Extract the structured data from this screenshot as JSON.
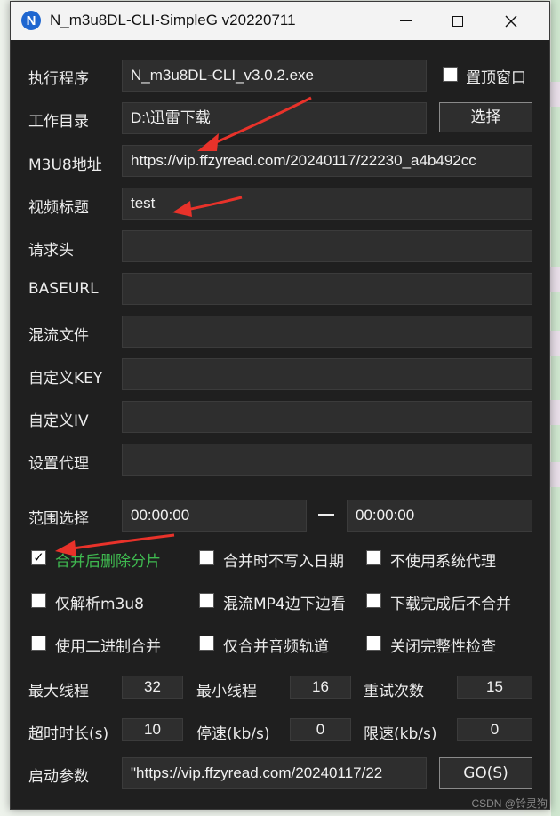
{
  "window": {
    "title": "N_m3u8DL-CLI-SimpleG v20220711",
    "app_icon_letter": "N"
  },
  "rows": {
    "exe": {
      "label": "执行程序",
      "value": "N_m3u8DL-CLI_v3.0.2.exe"
    },
    "topmost": {
      "label": "置顶窗口",
      "checked": false
    },
    "workdir": {
      "label": "工作目录",
      "value": "D:\\迅雷下载",
      "button": "选择"
    },
    "m3u8": {
      "label": "M3U8地址",
      "value": "https://vip.ffzyread.com/20240117/22230_a4b492cc"
    },
    "title": {
      "label": "视频标题",
      "value": "test"
    },
    "headers": {
      "label": "请求头",
      "value": ""
    },
    "baseurl": {
      "label": "BASEURL",
      "value": ""
    },
    "mux": {
      "label": "混流文件",
      "value": ""
    },
    "key": {
      "label": "自定义KEY",
      "value": ""
    },
    "iv": {
      "label": "自定义IV",
      "value": ""
    },
    "proxy": {
      "label": "设置代理",
      "value": ""
    },
    "range": {
      "label": "范围选择",
      "start": "00:00:00",
      "end": "00:00:00"
    }
  },
  "options": [
    {
      "label": "合并后删除分片",
      "checked": true
    },
    {
      "label": "合并时不写入日期",
      "checked": false
    },
    {
      "label": "不使用系统代理",
      "checked": false
    },
    {
      "label": "仅解析m3u8",
      "checked": false
    },
    {
      "label": "混流MP4边下边看",
      "checked": false
    },
    {
      "label": "下载完成后不合并",
      "checked": false
    },
    {
      "label": "使用二进制合并",
      "checked": false
    },
    {
      "label": "仅合并音频轨道",
      "checked": false
    },
    {
      "label": "关闭完整性检查",
      "checked": false
    }
  ],
  "numbers": {
    "max_threads": {
      "label": "最大线程",
      "value": "32"
    },
    "min_threads": {
      "label": "最小线程",
      "value": "16"
    },
    "retries": {
      "label": "重试次数",
      "value": "15"
    },
    "timeout": {
      "label": "超时时长(s)",
      "value": "10"
    },
    "stop_speed": {
      "label": "停速(kb/s)",
      "value": "0"
    },
    "limit_speed": {
      "label": "限速(kb/s)",
      "value": "0"
    }
  },
  "launch": {
    "label": "启动参数",
    "value": "\"https://vip.ffzyread.com/20240117/22",
    "go_button": "GO(S)"
  },
  "watermark": "CSDN @铃灵狗",
  "colors": {
    "window_bg": "#1f1f1f",
    "field_bg": "#2e2e2e",
    "checked_label": "#3fb950",
    "annotation_arrow": "#e8322a"
  }
}
